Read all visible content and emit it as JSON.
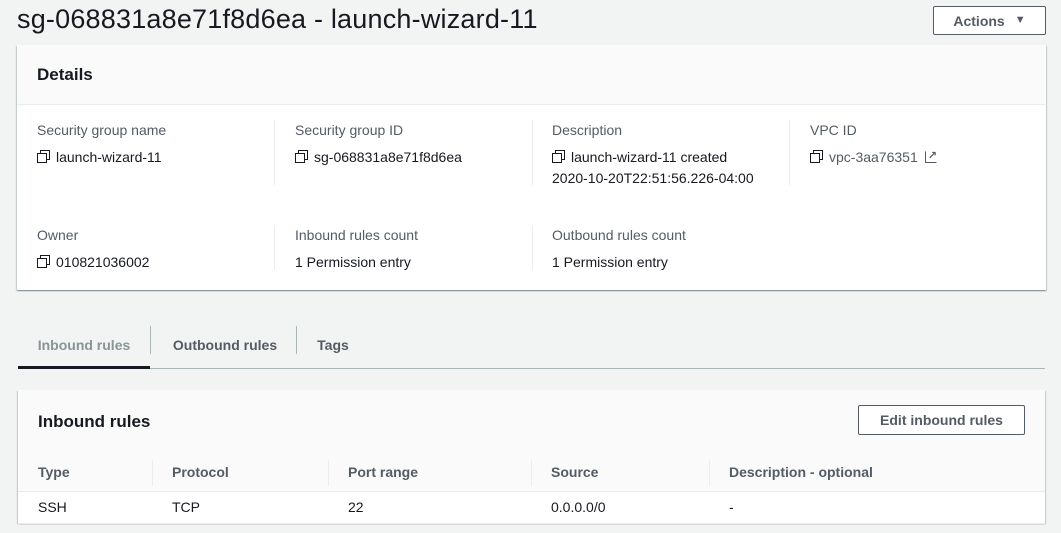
{
  "header": {
    "title": "sg-068831a8e71f8d6ea - launch-wizard-11",
    "actions_label": "Actions"
  },
  "details": {
    "title": "Details",
    "fields": [
      {
        "label": "Security group name",
        "value": "launch-wizard-11",
        "value2": ""
      },
      {
        "label": "Security group ID",
        "value": "sg-068831a8e71f8d6ea",
        "value2": ""
      },
      {
        "label": "Description",
        "value": "launch-wizard-11 created",
        "value2": "2020-10-20T22:51:56.226-04:00"
      },
      {
        "label": "VPC ID",
        "value": "vpc-3aa76351",
        "value2": ""
      },
      {
        "label": "Owner",
        "value": "010821036002",
        "value2": ""
      },
      {
        "label": "Inbound rules count",
        "value": "1 Permission entry",
        "value2": ""
      },
      {
        "label": "Outbound rules count",
        "value": "1 Permission entry",
        "value2": ""
      }
    ]
  },
  "tabs": [
    {
      "label": "Inbound rules",
      "active": true
    },
    {
      "label": "Outbound rules",
      "active": false
    },
    {
      "label": "Tags",
      "active": false
    }
  ],
  "inbound_rules": {
    "title": "Inbound rules",
    "edit_label": "Edit inbound rules",
    "columns": [
      "Type",
      "Protocol",
      "Port range",
      "Source",
      "Description - optional"
    ],
    "rows": [
      [
        "SSH",
        "TCP",
        "22",
        "0.0.0.0/0",
        "-"
      ]
    ]
  },
  "icons": {
    "copy": "copy-icon",
    "external": "external-link-icon",
    "dropdown": "caret-down-icon"
  },
  "colors": {
    "page_bg": "#f2f3f3",
    "text": "#16191f",
    "muted": "#545b64",
    "divider": "#eaeded"
  }
}
